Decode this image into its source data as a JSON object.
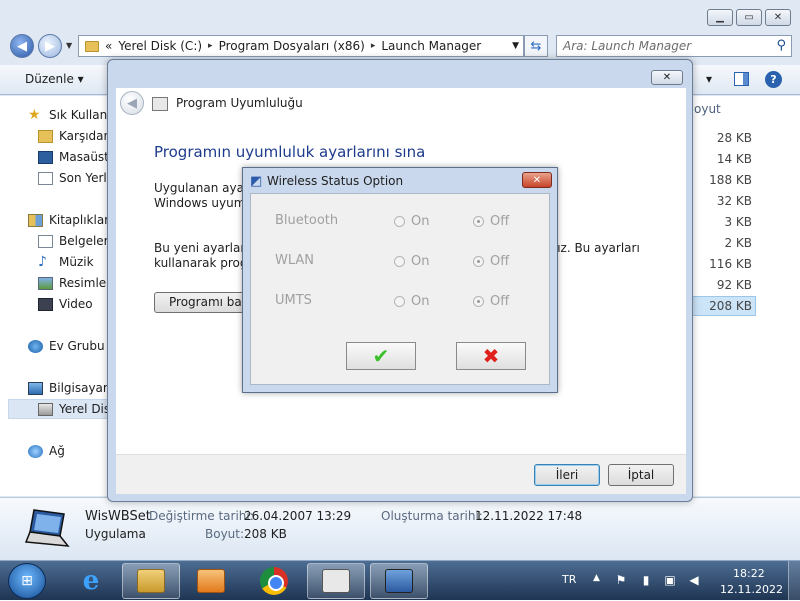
{
  "explorer": {
    "address": {
      "chevron": "«",
      "segments": [
        "Yerel Disk (C:)",
        "Program Dosyaları (x86)",
        "Launch Manager"
      ],
      "separator": "▸"
    },
    "search_placeholder": "Ara: Launch Manager",
    "organize_label": "Düzenle ▾",
    "nav": {
      "favorites": "Sık Kullanıla",
      "downloads": "Karşıdan Y",
      "desktop": "Masaüstü",
      "recent": "Son Yerle",
      "libraries": "Kitaplıklar",
      "documents": "Belgeler",
      "music": "Müzik",
      "pictures": "Resimler",
      "videos": "Video",
      "homegroup": "Ev Grubu",
      "computer": "Bilgisayar",
      "local_disk": "Yerel Disk",
      "network": "Ağ"
    },
    "size_column": "oyut",
    "sizes": [
      "28 KB",
      "14 KB",
      "188 KB",
      "32 KB",
      "3 KB",
      "2 KB",
      "116 KB",
      "92 KB",
      "208 KB"
    ],
    "details": {
      "name": "WisWBSet",
      "type": "Uygulama",
      "modified_label": "Değiştirme tarihi:",
      "modified_value": "26.04.2007 13:29",
      "created_label": "Oluşturma tarihi:",
      "created_value": "12.11.2022 17:48",
      "size_label": "Boyut:",
      "size_value": "208 KB"
    }
  },
  "wizard": {
    "title": "Program Uyumluluğu",
    "heading": "Programın uyumluluk ayarlarını sına",
    "text1_line1": "Uygulanan ayarla",
    "text1_line2": "Windows uyumlu",
    "text2_line1_left": "Bu yeni ayarların",
    "text2_line1_right": "sınız. Bu ayarları",
    "text2_line2": "kullanarak progra",
    "try_button": "Programı başl",
    "next_button": "İleri",
    "cancel_button": "İptal"
  },
  "wireless": {
    "title": "Wireless Status Option",
    "rows": [
      {
        "label": "Bluetooth",
        "on": "On",
        "off": "Off"
      },
      {
        "label": "WLAN",
        "on": "On",
        "off": "Off"
      },
      {
        "label": "UMTS",
        "on": "On",
        "off": "Off"
      }
    ],
    "ok_symbol": "✔",
    "cancel_symbol": "✖"
  },
  "taskbar": {
    "language": "TR",
    "time": "18:22",
    "date": "12.11.2022"
  },
  "colors": {
    "heading_blue": "#1e3c8c",
    "ok_green": "#3bbf2a",
    "cancel_red": "#e0201c"
  }
}
